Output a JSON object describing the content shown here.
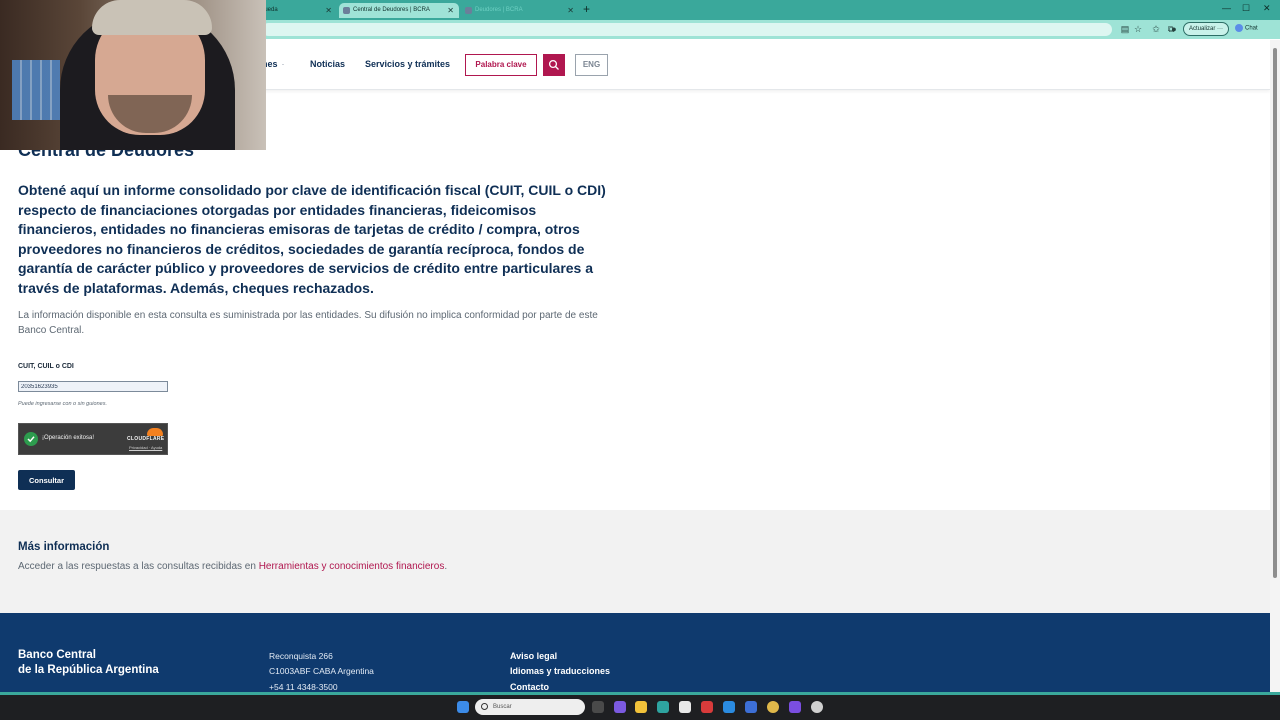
{
  "browser": {
    "tabs": [
      {
        "title": "quedа"
      },
      {
        "title": "Central de Deudores | BCRA"
      },
      {
        "title": "Deudores | BCRA"
      }
    ],
    "update_label": "Actualizar ···",
    "chat_label": "Chat"
  },
  "header": {
    "nav_items": [
      "nes",
      "Noticias",
      "Servicios y trámites"
    ],
    "keyword_label": "Palabra clave",
    "lang_label": "ENG"
  },
  "main": {
    "title": "Central de Deudores",
    "lead": "Obtené aquí un informe consolidado por clave de identificación fiscal (CUIT, CUIL o CDI) respecto de financiaciones otorgadas por entidades financieras, fideicomisos financieros, entidades no financieras emisoras de tarjetas de crédito / compra, otros proveedores no financieros de créditos, sociedades de garantía recíproca, fondos de garantía de carácter público y proveedores de servicios de crédito entre particulares a través de plataformas. Además, cheques rechazados.",
    "disclaimer": "La información disponible en esta consulta es suministrada por las entidades. Su difusión no implica conformidad por parte de este Banco Central.",
    "field_label": "CUIT, CUIL o CDI",
    "field_value": "20351623935",
    "hint": "Puede ingresarse con o sin guiones.",
    "captcha_text": "¡Operación exitosa!",
    "captcha_brand": "CLOUDFLARE",
    "captcha_links": "Privacidad · Ayuda",
    "submit_label": "Consultar"
  },
  "more_info": {
    "title": "Más información",
    "text": "Acceder a las respuestas a las consultas recibidas en ",
    "link": "Herramientas y conocimientos financieros",
    "text_end": "."
  },
  "footer": {
    "brand_line1": "Banco Central",
    "brand_line2": "de la República Argentina",
    "address": [
      "Reconquista 266",
      "C1003ABF CABA Argentina",
      "+54 11 4348-3500"
    ],
    "links": [
      "Aviso legal",
      "Idiomas y traducciones",
      "Contacto"
    ]
  },
  "taskbar": {
    "search_placeholder": "Buscar"
  },
  "colors": {
    "primary": "#0f2f55",
    "accent": "#b0174f",
    "footer_bg": "#0f3a6e",
    "browser_chrome": "#3aa89b"
  }
}
